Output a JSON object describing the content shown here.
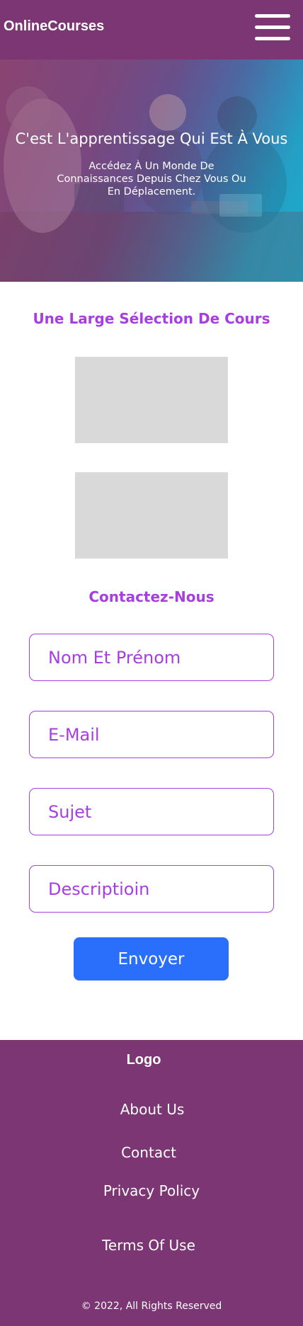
{
  "header": {
    "brand": "OnlineCourses",
    "menu_icon": "hamburger-menu-icon"
  },
  "hero": {
    "title": "C'est L'apprentissage Qui Est À Vous",
    "subtitle": "Accédez À Un Monde De Connaissances Depuis Chez Vous Ou En Déplacement."
  },
  "courses": {
    "title": "Une Large Sélection De Cours"
  },
  "contact": {
    "title": "Contactez-Nous",
    "name_placeholder": "Nom Et Prénom",
    "email_placeholder": "E-Mail",
    "subject_placeholder": "Sujet",
    "description_placeholder": "Descriptioin",
    "submit_label": "Envoyer"
  },
  "footer": {
    "logo": "Logo",
    "links": [
      "About Us",
      "Contact",
      "Privacy Policy",
      "Terms Of Use"
    ],
    "copyright": "© 2022,  All Rights Reserved"
  },
  "colors": {
    "brand_purple": "#7b3673",
    "accent_purple": "#a63ee0",
    "button_blue": "#2a6efc",
    "placeholder_gray": "#d9d9d9"
  }
}
